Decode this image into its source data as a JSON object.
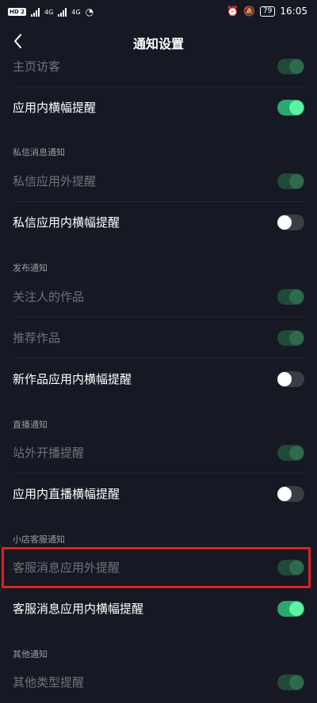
{
  "status_bar": {
    "hd": "HD 2",
    "sig1": "4G",
    "sig2": "4G",
    "battery": "79",
    "time": "16:05"
  },
  "header": {
    "title": "通知设置"
  },
  "rows": [
    {
      "label": "主页访客",
      "state": "disabled-on"
    },
    {
      "label": "应用内横幅提醒",
      "state": "on"
    },
    {
      "label": "私信应用外提醒",
      "state": "disabled-on"
    },
    {
      "label": "私信应用内横幅提醒",
      "state": "off"
    },
    {
      "label": "关注人的作品",
      "state": "disabled-on"
    },
    {
      "label": "推荐作品",
      "state": "disabled-on"
    },
    {
      "label": "新作品应用内横幅提醒",
      "state": "off"
    },
    {
      "label": "站外开播提醒",
      "state": "disabled-on"
    },
    {
      "label": "应用内直播横幅提醒",
      "state": "off"
    },
    {
      "label": "客服消息应用外提醒",
      "state": "disabled-on"
    },
    {
      "label": "客服消息应用内横幅提醒",
      "state": "on"
    },
    {
      "label": "其他类型提醒",
      "state": "disabled-on"
    }
  ],
  "sections": [
    {
      "label": "私信消息通知"
    },
    {
      "label": "发布通知"
    },
    {
      "label": "直播通知"
    },
    {
      "label": "小店客服通知"
    },
    {
      "label": "其他通知"
    }
  ],
  "colors": {
    "background": "#161823",
    "toggle_on": "#2aa86e",
    "highlight": "#e02020"
  }
}
